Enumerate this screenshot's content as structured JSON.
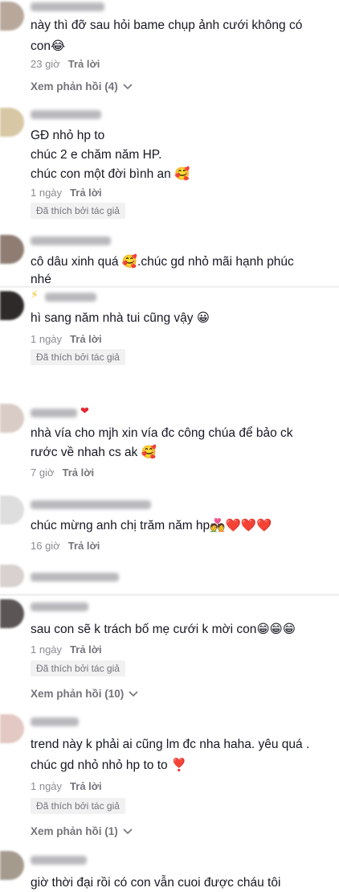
{
  "comments": [
    {
      "text_lines": [
        "này thì đỡ sau hỏi bame chụp ảnh cưới không có",
        "con😂"
      ],
      "time": "23 giờ",
      "reply_label": "Trả lời",
      "view_replies": "Xem phản hồi (4)"
    },
    {
      "text_lines": [
        "GĐ nhỏ hp to",
        "chúc 2 e chăm năm HP.",
        "chúc con một đời bình an 🥰"
      ],
      "time": "1 ngày",
      "reply_label": "Trả lời",
      "liked_by_author": "Đã thích bởi tác giả"
    },
    {
      "text_lines": [
        "cô dâu xinh quá 🥰.chúc gd nhỏ mãi hạnh phúc",
        "nhé"
      ]
    },
    {
      "text_lines": [
        "hì sang năm nhà tui cũng vậy 😀"
      ],
      "time": "1 ngày",
      "reply_label": "Trả lời",
      "liked_by_author": "Đã thích bởi tác giả"
    },
    {
      "text_lines": [
        "nhà vía cho mjh xin vía đc công chúa để bảo ck",
        "rước về nhah cs ak 🥰"
      ],
      "time": "7 giờ",
      "reply_label": "Trả lời"
    },
    {
      "text_lines": [
        "chúc mừng anh chị trăm năm hp💑❤️❤️❤️"
      ],
      "time": "16 giờ",
      "reply_label": "Trả lời"
    },
    {
      "text_lines": [
        "sau con sẽ k trách bố mẹ cưới k mời con😁😁😁"
      ],
      "time": "1 ngày",
      "reply_label": "Trả lời",
      "liked_by_author": "Đã thích bởi tác giả",
      "view_replies": "Xem phản hồi (10)"
    },
    {
      "text_lines": [
        "trend này k phải ai cũng lm đc nha haha. yêu quá .",
        "chúc gd nhỏ nhỏ hp to to ❣️"
      ],
      "time": "1 ngày",
      "reply_label": "Trả lời",
      "liked_by_author": "Đã thích bởi tác giả",
      "view_replies": "Xem phản hồi (1)"
    },
    {
      "text_lines": [
        "giờ thời đại rồi có con vẫn cuoi được cháu tôi"
      ]
    }
  ],
  "icons": {
    "chevron": "chevron-down-icon",
    "heart": "red-heart-icon",
    "bolt": "lightning-icon"
  },
  "colors": {
    "text": "#161823",
    "meta": "#8a8b91",
    "badge_bg": "#f1f1f2"
  }
}
